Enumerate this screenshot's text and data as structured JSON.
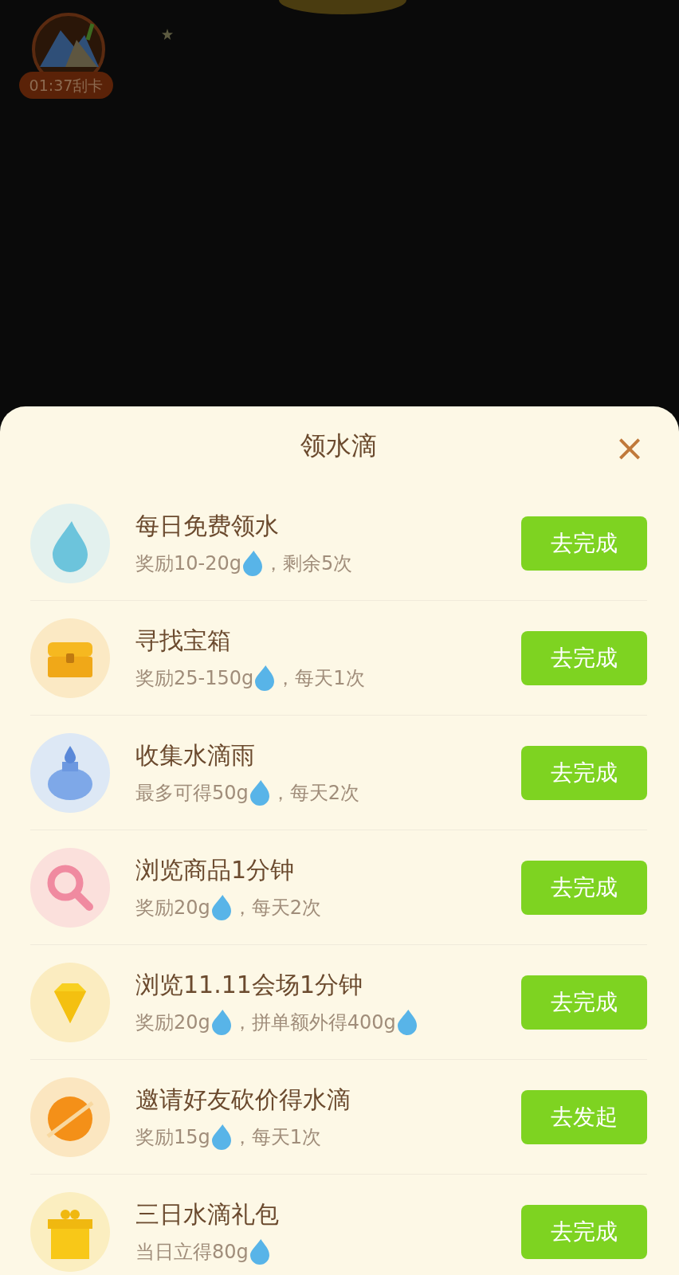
{
  "timer_badge": {
    "label": "01:37刮卡"
  },
  "sheet": {
    "title": "领水滴",
    "close": "×"
  },
  "tasks": [
    {
      "kind": "drop",
      "title": "每日免费领水",
      "sub": [
        {
          "kind": "text",
          "text": "奖励10-20g"
        },
        {
          "kind": "drop"
        },
        {
          "kind": "text",
          "text": "，剩余5次"
        }
      ],
      "button": "去完成"
    },
    {
      "kind": "chest",
      "title": "寻找宝箱",
      "sub": [
        {
          "kind": "text",
          "text": "奖励25-150g"
        },
        {
          "kind": "drop"
        },
        {
          "kind": "text",
          "text": "，每天1次"
        }
      ],
      "button": "去完成"
    },
    {
      "kind": "jar",
      "title": "收集水滴雨",
      "sub": [
        {
          "kind": "text",
          "text": "最多可得50g"
        },
        {
          "kind": "drop"
        },
        {
          "kind": "text",
          "text": "，每天2次"
        }
      ],
      "button": "去完成"
    },
    {
      "kind": "search",
      "title": "浏览商品1分钟",
      "sub": [
        {
          "kind": "text",
          "text": "奖励20g"
        },
        {
          "kind": "drop"
        },
        {
          "kind": "text",
          "text": "，每天2次"
        }
      ],
      "button": "去完成"
    },
    {
      "kind": "diamond",
      "title": "浏览11.11会场1分钟",
      "sub": [
        {
          "kind": "text",
          "text": "奖励20g"
        },
        {
          "kind": "drop"
        },
        {
          "kind": "text",
          "text": "，拼单额外得400g"
        },
        {
          "kind": "drop"
        }
      ],
      "button": "去完成"
    },
    {
      "kind": "orange",
      "title": "邀请好友砍价得水滴",
      "sub": [
        {
          "kind": "text",
          "text": "奖励15g"
        },
        {
          "kind": "drop"
        },
        {
          "kind": "text",
          "text": "，每天1次"
        }
      ],
      "button": "去发起"
    },
    {
      "kind": "gift",
      "title": "三日水滴礼包",
      "sub": [
        {
          "kind": "text",
          "text": "当日立得80g"
        },
        {
          "kind": "drop"
        }
      ],
      "button": "去完成"
    }
  ]
}
